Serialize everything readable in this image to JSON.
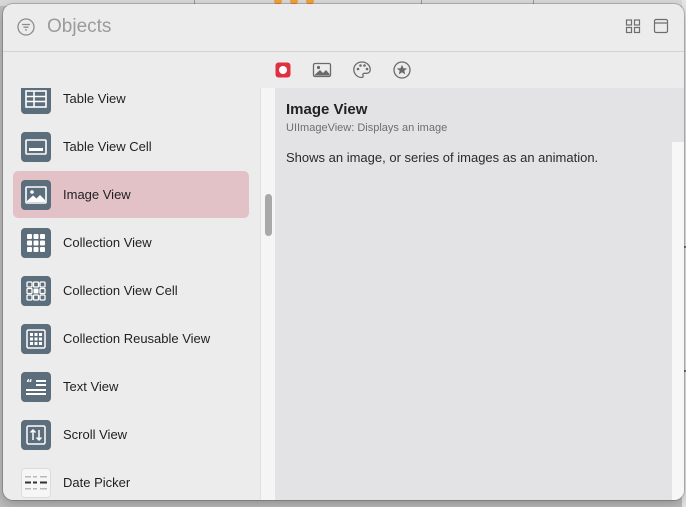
{
  "window": {
    "search_placeholder": "Objects"
  },
  "header_icons": [
    "filter-icon",
    "grid-view-icon",
    "window-view-icon"
  ],
  "tabs": [
    {
      "name": "objects-icon",
      "selected": true,
      "color": "#e0303f"
    },
    {
      "name": "image-icon",
      "selected": false
    },
    {
      "name": "palette-icon",
      "selected": false
    },
    {
      "name": "star-icon",
      "selected": false
    }
  ],
  "library": {
    "items": [
      {
        "label": "Table View",
        "icon": "table-view-icon"
      },
      {
        "label": "Table View Cell",
        "icon": "table-view-cell-icon"
      },
      {
        "label": "Image View",
        "icon": "image-view-icon",
        "selected": true
      },
      {
        "label": "Collection View",
        "icon": "collection-view-icon"
      },
      {
        "label": "Collection View Cell",
        "icon": "collection-view-cell-icon"
      },
      {
        "label": "Collection Reusable View",
        "icon": "collection-reusable-view-icon"
      },
      {
        "label": "Text View",
        "icon": "text-view-icon"
      },
      {
        "label": "Scroll View",
        "icon": "scroll-view-icon"
      },
      {
        "label": "Date Picker",
        "icon": "date-picker-icon"
      }
    ]
  },
  "detail": {
    "title": "Image View",
    "subtitle": "UIImageView: Displays an image",
    "description": "Shows an image, or series of images as an animation."
  },
  "colors": {
    "selection": "#e3c2c7",
    "icon_tile": "#5c6d7c",
    "accent_red": "#e0303f"
  }
}
